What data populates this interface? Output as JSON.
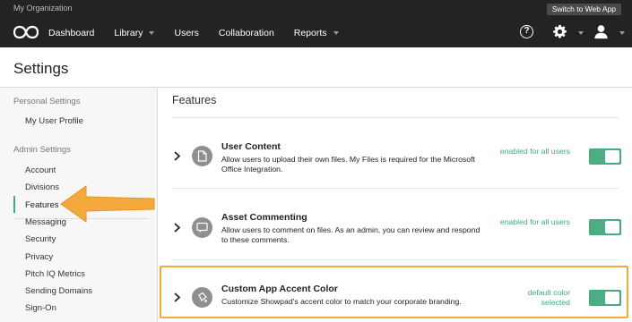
{
  "topbar": {
    "org_name": "My Organization",
    "switch_label": "Switch to Web App",
    "logo_icon": "showpad-logo-icon",
    "nav": [
      {
        "label": "Dashboard",
        "dropdown": false
      },
      {
        "label": "Library",
        "dropdown": true
      },
      {
        "label": "Users",
        "dropdown": false
      },
      {
        "label": "Collaboration",
        "dropdown": false
      },
      {
        "label": "Reports",
        "dropdown": true
      }
    ],
    "help_glyph": "?",
    "icons": [
      "help-icon",
      "gear-icon",
      "user-icon"
    ]
  },
  "page": {
    "title": "Settings"
  },
  "sidebar": {
    "personal_heading": "Personal Settings",
    "personal_items": [
      "My User Profile"
    ],
    "admin_heading": "Admin Settings",
    "admin_items": [
      "Account",
      "Divisions",
      "Features",
      "Messaging",
      "Security",
      "Privacy",
      "Pitch IQ Metrics",
      "Sending Domains",
      "Sign-On"
    ],
    "active_item": "Features"
  },
  "main": {
    "heading": "Features",
    "features": [
      {
        "title": "User Content",
        "description": "Allow users to upload their own files. My Files is required for the Microsoft Office Integration.",
        "status": "enabled for all users",
        "icon": "document-icon",
        "toggle_on": true
      },
      {
        "title": "Asset Commenting",
        "description": "Allow users to comment on files. As an admin, you can review and respond to these comments.",
        "status": "enabled for all users",
        "icon": "comment-icon",
        "toggle_on": true
      },
      {
        "title": "Custom App Accent Color",
        "description": "Customize Showpad's accent color to match your corporate branding.",
        "status": "default color selected",
        "icon": "paint-bucket-icon",
        "toggle_on": true
      }
    ]
  },
  "colors": {
    "topbar": "#232323",
    "accent_green": "#3bae78",
    "toggle_green": "#4caf84",
    "highlight_orange": "#f5a83b"
  }
}
